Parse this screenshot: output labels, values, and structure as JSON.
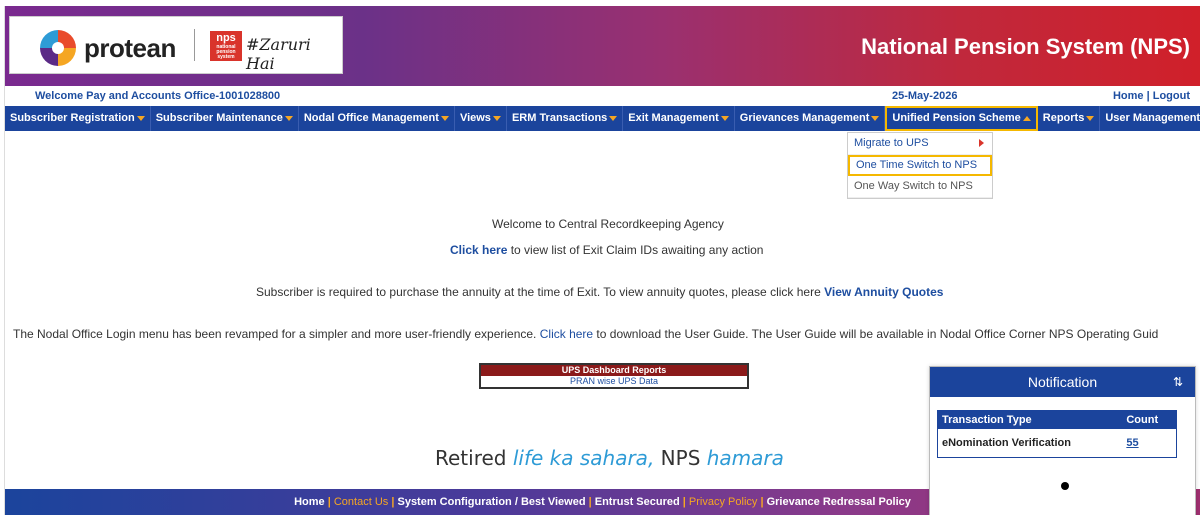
{
  "header": {
    "brand": "protean",
    "nps_logo": "nps",
    "nps_logo_sub": "national pension system",
    "slogan": "#Zaruri Hai",
    "title": "National Pension System (NPS)"
  },
  "infobar": {
    "welcome": "Welcome Pay and Accounts Office-1001028800",
    "date": "25-May-2026",
    "home_logout": "Home | Logout"
  },
  "menu": [
    {
      "label": "Subscriber Registration"
    },
    {
      "label": "Subscriber Maintenance"
    },
    {
      "label": "Nodal Office Management"
    },
    {
      "label": "Views"
    },
    {
      "label": "ERM Transactions"
    },
    {
      "label": "Exit Management"
    },
    {
      "label": "Grievances Management"
    },
    {
      "label": "Unified Pension Scheme"
    },
    {
      "label": "Reports"
    },
    {
      "label": "User Management"
    }
  ],
  "dropdown": [
    {
      "label": "Migrate to UPS"
    },
    {
      "label": "One Time Switch to NPS"
    },
    {
      "label": "One Way Switch to NPS"
    }
  ],
  "messages": {
    "welcome_cra": "Welcome to Central Recordkeeping Agency",
    "click_here": "Click here",
    "exit_claim_text": " to view list of Exit Claim IDs awaiting any action",
    "annuity_text": "Subscriber is required to purchase the annuity at the time of Exit. To view annuity quotes, please click here ",
    "annuity_link": "View Annuity Quotes",
    "nodal_pre": "The Nodal Office Login menu has been revamped for a simpler and more user-friendly experience. ",
    "nodal_link": "Click here",
    "nodal_post": " to download the User Guide. The User Guide will be available in Nodal Office Corner NPS Operating Guid"
  },
  "ups": {
    "header": "UPS Dashboard Reports",
    "link": "PRAN wise UPS Data"
  },
  "tagline": {
    "part1": "Retired ",
    "part2": "life ka sahara,",
    "part3": " NPS ",
    "part4": "hamara"
  },
  "footer": {
    "home": "Home",
    "contact": "Contact Us",
    "sys": "System Configuration / Best Viewed",
    "entrust": "Entrust Secured",
    "privacy": "Privacy Policy",
    "grievance": "Grievance Redressal Policy"
  },
  "notification": {
    "title": "Notification",
    "col_type": "Transaction Type",
    "col_count": "Count",
    "row_type": "eNomination Verification",
    "row_count": "55"
  },
  "colors": {
    "menu_bg": "#1b449c",
    "highlight": "#f5b800",
    "link": "#1e4ea0"
  }
}
